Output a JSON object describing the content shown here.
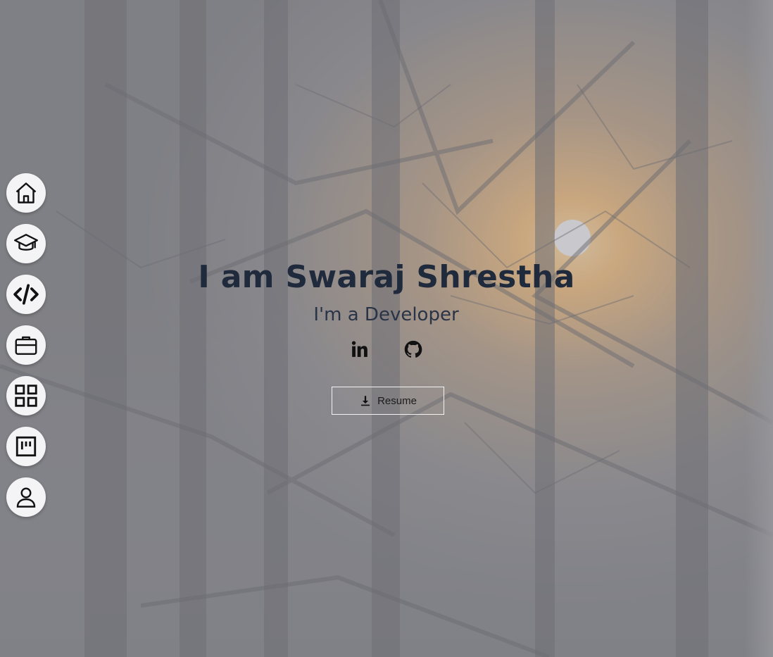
{
  "hero": {
    "title": "I am Swaraj Shrestha",
    "subtitle": "I'm a Developer"
  },
  "socials": [
    {
      "icon": "linkedin-icon"
    },
    {
      "icon": "github-icon"
    }
  ],
  "resume": {
    "label": "Resume",
    "icon": "download-icon"
  },
  "nav": {
    "items": [
      {
        "icon": "home-icon"
      },
      {
        "icon": "graduation-cap-icon"
      },
      {
        "icon": "code-icon"
      },
      {
        "icon": "briefcase-icon"
      },
      {
        "icon": "grid-icon"
      },
      {
        "icon": "board-icon"
      },
      {
        "icon": "user-icon"
      }
    ]
  },
  "colors": {
    "title": "#1f2a3c",
    "nav_bg": "#f4f4f6",
    "overlay": "#96969b"
  }
}
